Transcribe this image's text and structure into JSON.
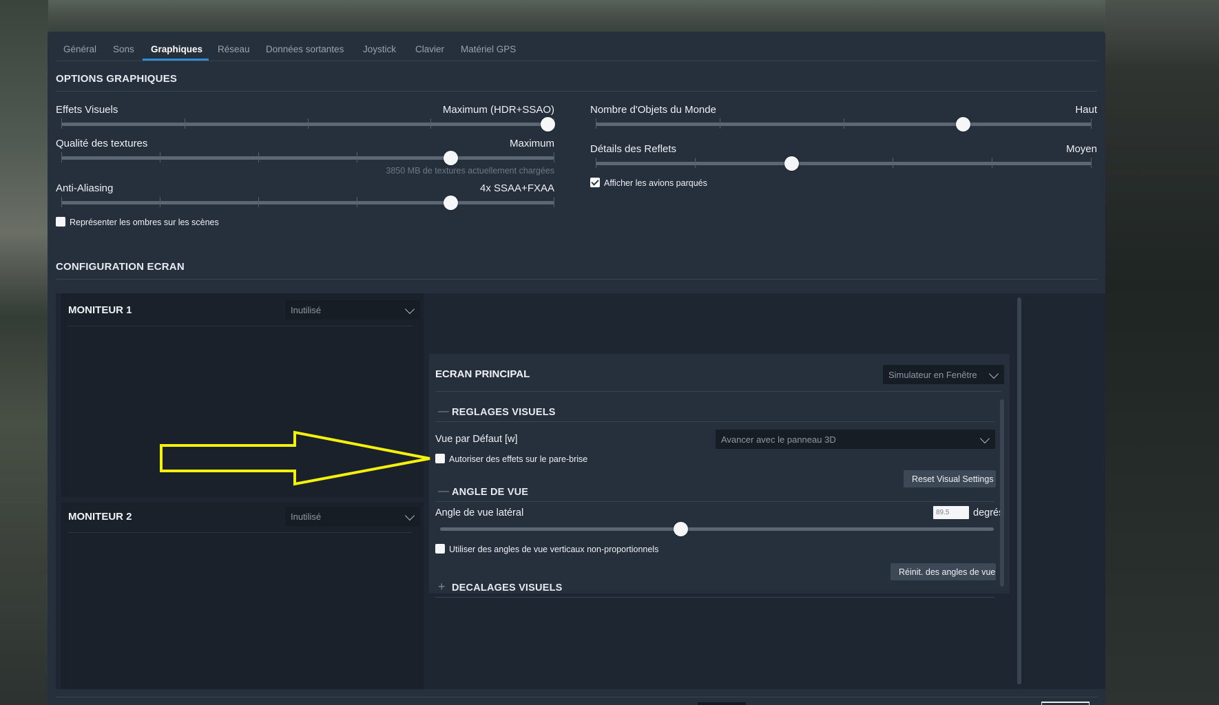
{
  "tabs": [
    {
      "label": "Général",
      "active": false
    },
    {
      "label": "Sons",
      "active": false
    },
    {
      "label": "Graphiques",
      "active": true
    },
    {
      "label": "Réseau",
      "active": false
    },
    {
      "label": "Données sortantes",
      "active": false
    },
    {
      "label": "Joystick",
      "active": false
    },
    {
      "label": "Clavier",
      "active": false
    },
    {
      "label": "Matériel GPS",
      "active": false
    }
  ],
  "graphics": {
    "title": "OPTIONS GRAPHIQUES",
    "visual_effects": {
      "label": "Effets Visuels",
      "value": "Maximum (HDR+SSAO)",
      "level": 1.0,
      "steps": 5
    },
    "texture_quality": {
      "label": "Qualité des textures",
      "value": "Maximum",
      "level": 0.8,
      "steps": 6,
      "note": "3850 MB de textures actuellement chargées"
    },
    "anti_aliasing": {
      "label": "Anti-Aliasing",
      "value": "4x SSAA+FXAA",
      "level": 0.8,
      "steps": 6
    },
    "shadows_checkbox": {
      "label": "Représenter les ombres sur les scènes",
      "checked": false
    },
    "world_objects": {
      "label": "Nombre d'Objets du Monde",
      "value": "Haut",
      "level": 0.75,
      "steps": 5
    },
    "reflection_detail": {
      "label": "Détails des Reflets",
      "value": "Moyen",
      "level": 0.4,
      "steps": 6
    },
    "parked_planes_checkbox": {
      "label": "Afficher les avions parqués",
      "checked": true
    }
  },
  "screen_config": {
    "title": "CONFIGURATION ECRAN",
    "monitor1": {
      "title": "MONITEUR 1",
      "dropdown": "Inutilisé"
    },
    "monitor2": {
      "title": "MONITEUR 2",
      "dropdown": "Inutilisé"
    },
    "main_screen": {
      "title": "ECRAN PRINCIPAL",
      "dropdown": "Simulateur en Fenêtre",
      "visual_settings": {
        "title": "REGLAGES VISUELS",
        "default_view_label": "Vue par Défaut [w]",
        "default_view_value": "Avancer avec le panneau 3D",
        "windshield_checkbox": {
          "label": "Autoriser des effets sur le pare-brise",
          "checked": false
        },
        "reset_button": "Reset Visual Settings"
      },
      "view_angle": {
        "title": "ANGLE DE VUE",
        "lateral_label": "Angle de vue latéral",
        "lateral_value": "89.5",
        "unit": "degrés",
        "level": 0.44,
        "nonprop_checkbox": {
          "label": "Utiliser des angles de vue verticaux non-proportionnels",
          "checked": false
        },
        "reset_button": "Réinit. des angles de vue"
      },
      "visual_offsets": {
        "title": "DECALAGES VISUELS"
      }
    }
  },
  "colors": {
    "accent": "#2f8fd4",
    "annotation_arrow": "#f5f10a"
  }
}
